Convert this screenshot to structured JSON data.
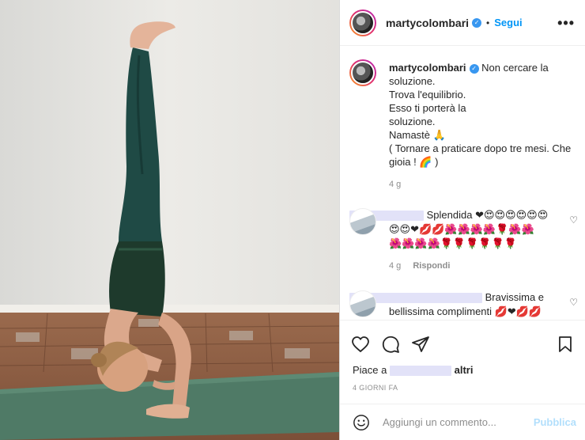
{
  "post": {
    "username": "martycolombari",
    "verified": true,
    "follow_label": "Segui",
    "more_icon": "more-options-icon"
  },
  "caption": {
    "username": "martycolombari",
    "lines": [
      "Non cercare la",
      "soluzione.",
      "Trova l'equilibrio.",
      "Esso ti porterà la",
      "soluzione.",
      "Namastè 🙏",
      "( Tornare a praticare dopo tre mesi. Che",
      "gioia ! 🌈 )"
    ],
    "time": "4 g"
  },
  "comments": [
    {
      "text_line1": "Splendida ❤😍😍😍😍😍😍",
      "text_line2": "😍😍❤💋💋🌺🌺🌺🌺🌹🌺🌺",
      "text_line3": "🌺🌺🌺🌺🌹🌹🌹🌹🌹🌹",
      "time": "4 g",
      "reply_label": "Rispondi"
    },
    {
      "text_line1": "Bravissima e",
      "text_line2": "bellissima complimenti 💋❤💋💋",
      "text_line3": "💋💋💋💋💋🌺🌺🌺🌺🌺🌺"
    }
  ],
  "actions": {
    "likes_prefix": "Piace a",
    "likes_suffix": "altri",
    "time_ago": "4 GIORNI FA"
  },
  "add_comment": {
    "placeholder": "Aggiungi un commento...",
    "publish_label": "Pubblica"
  },
  "colors": {
    "accent": "#0095f6",
    "publish_disabled": "#b2dffc",
    "secondary_text": "#8e8e8e"
  }
}
